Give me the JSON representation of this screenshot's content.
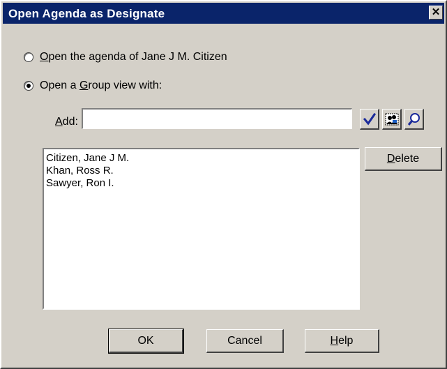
{
  "window": {
    "title": "Open Agenda as Designate",
    "close_glyph": "✕"
  },
  "options": {
    "open_agenda": {
      "mnemonic": "O",
      "rest": "pen the agenda of Jane J M. Citizen",
      "checked": false
    },
    "group_view": {
      "prefix": "Open a ",
      "mnemonic": "G",
      "rest": "roup view with:",
      "checked": true
    }
  },
  "add": {
    "mnemonic": "A",
    "rest": "dd:",
    "value": "",
    "placeholder": ""
  },
  "toolbar": {
    "check_icon": "checkmark-icon",
    "address_book_icon": "address-book-icon",
    "search_icon": "magnifier-icon"
  },
  "list": {
    "items": [
      "Citizen, Jane J M.",
      "Khan, Ross R.",
      "Sawyer, Ron I."
    ]
  },
  "buttons": {
    "delete": {
      "mnemonic": "D",
      "rest": "elete"
    },
    "ok": "OK",
    "cancel": "Cancel",
    "help": {
      "mnemonic": "H",
      "rest": "elp"
    }
  }
}
